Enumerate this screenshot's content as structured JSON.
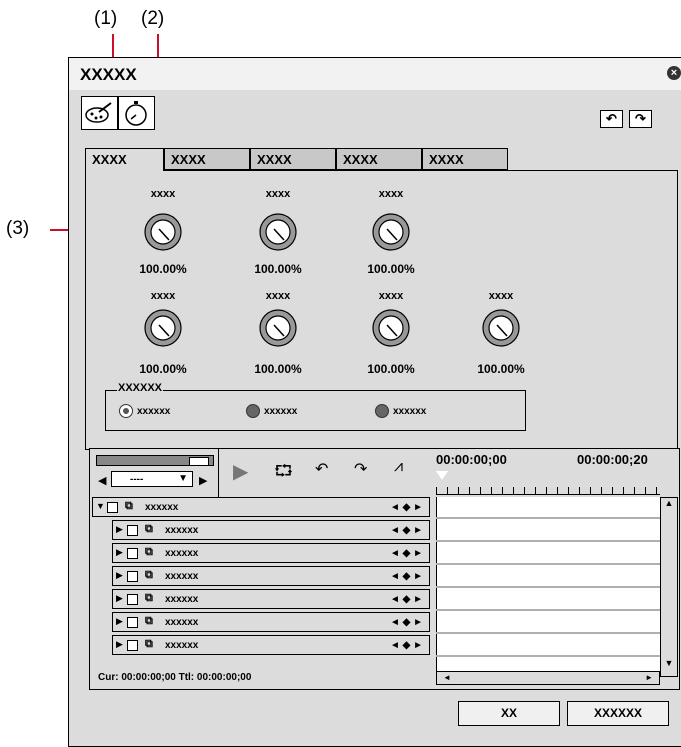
{
  "callouts": [
    "(1)",
    "(2)",
    "(3)"
  ],
  "window": {
    "title": "XXXXX",
    "close_icon": "close-icon"
  },
  "toolbar": {
    "icons": [
      "palette-icon",
      "stopwatch-icon"
    ],
    "undo_icon": "undo-icon",
    "redo_icon": "redo-icon"
  },
  "tabs": [
    "XXXX",
    "XXXX",
    "XXXX",
    "XXXX",
    "XXXX"
  ],
  "knobs_row1": [
    {
      "label": "xxxx",
      "value": "100.00%"
    },
    {
      "label": "xxxx",
      "value": "100.00%"
    },
    {
      "label": "xxxx",
      "value": "100.00%"
    }
  ],
  "knobs_row2": [
    {
      "label": "xxxx",
      "value": "100.00%"
    },
    {
      "label": "xxxx",
      "value": "100.00%"
    },
    {
      "label": "xxxx",
      "value": "100.00%"
    },
    {
      "label": "xxxx",
      "value": "100.00%"
    }
  ],
  "radio_group": {
    "title": "XXXXXX",
    "options": [
      "xxxxxx",
      "xxxxxx",
      "xxxxxx"
    ],
    "selected_index": 0
  },
  "timeline": {
    "dropdown_value": "----",
    "timecode_start": "00:00:00;00",
    "timecode_end": "00:00:00;20",
    "tracks": [
      {
        "label": "xxxxxx",
        "parent": true
      },
      {
        "label": "xxxxxx"
      },
      {
        "label": "xxxxxx"
      },
      {
        "label": "xxxxxx"
      },
      {
        "label": "xxxxxx"
      },
      {
        "label": "xxxxxx"
      },
      {
        "label": "xxxxxx"
      }
    ],
    "status": "Cur: 00:00:00;00   Ttl: 00:00:00;00",
    "keyframe_nav": "◄ ◆ ►"
  },
  "buttons": {
    "ok": "XX",
    "cancel": "XXXXXX"
  },
  "colors": {
    "callout_line": "#c8102e",
    "window_bg": "#dcdcdc"
  }
}
